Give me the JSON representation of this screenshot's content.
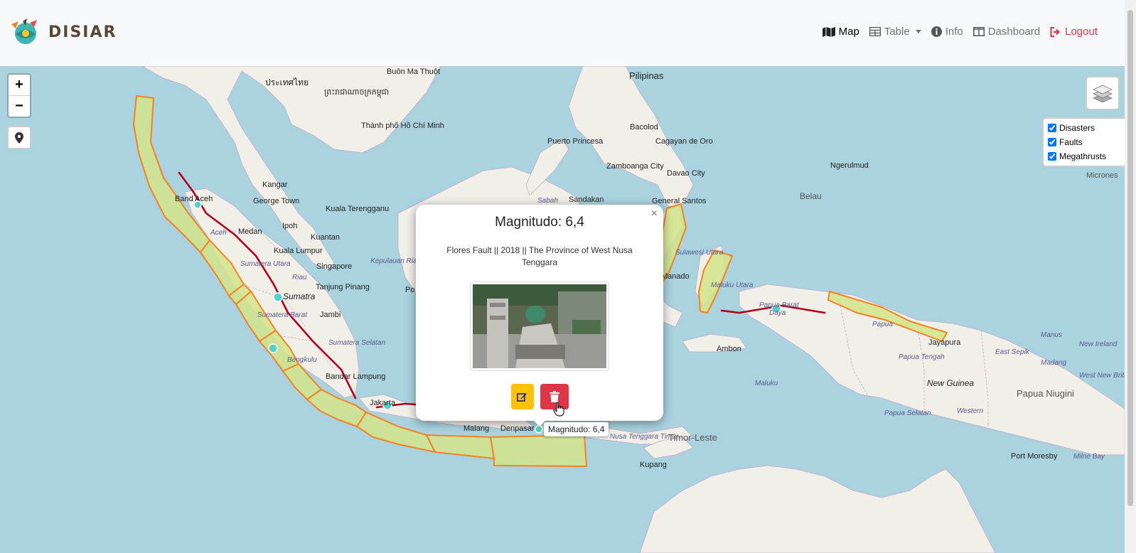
{
  "brand": {
    "name": "DISIAR"
  },
  "nav": {
    "map": "Map",
    "table": "Table",
    "info": "Info",
    "dashboard": "Dashboard",
    "logout": "Logout"
  },
  "map_controls": {
    "zoom_in": "+",
    "zoom_out": "−"
  },
  "layers": {
    "disasters": "Disasters",
    "faults": "Faults",
    "megathrusts": "Megathrusts"
  },
  "popup": {
    "title": "Magnitudo: 6,4",
    "description": "Flores Fault || 2018 || The Province of West Nusa Tenggara",
    "close": "×"
  },
  "tooltip": "Magnitudo: 6,4",
  "map_labels": {
    "pilipinas": "Pilipinas",
    "buon_ma_thuot": "Buôn Ma Thuột",
    "prathet_thai": "ประเทศไทย",
    "kampuchea": "ព្រះរាជាណាចក្រកម្ពុជា",
    "ho_chi_minh": "Thành phố Hồ Chí Minh",
    "puerto_princesa": "Puerto Princesa",
    "bacolod": "Bacolod",
    "cagayan": "Cagayan de Oro",
    "zamboanga": "Zamboanga City",
    "davao": "Davao City",
    "general_santos": "General Santos",
    "ngerulmud": "Ngerulmud",
    "belau": "Belau",
    "micronesia": "Micrones",
    "sandakan": "Sandakan",
    "sabah": "Sabah",
    "kangar": "Kangar",
    "george_town": "George Town",
    "kuala_terengganu": "Kuala Terengganu",
    "ipoh": "Ipoh",
    "kuantan": "Kuantan",
    "kuala_lumpur": "Kuala Lumpur",
    "singapore": "Singapore",
    "tanjung_pinang": "Tanjung Pinang",
    "banda_aceh": "Band Aceh",
    "aceh": "Aceh",
    "medan": "Medan",
    "sumatera_utara": "Sumatera Utara",
    "riau": "Riau",
    "kepulauan_riau": "Kepulauan Riau",
    "sumatra": "Sumatra",
    "sumatera_barat": "Sumatera Barat",
    "jambi": "Jambi",
    "sumatera_selatan": "Sumatera Selatan",
    "bengkulu": "Bengkulu",
    "bandar_lampung": "Bandar Lampung",
    "jakarta": "Jakarta",
    "malang": "Malang",
    "denpasar": "Denpasar",
    "nusa_tenggara_timur": "Nusa Tenggara Timur",
    "timor_leste": "Timor-Leste",
    "kupang": "Kupang",
    "ambon": "Ambon",
    "maluku": "Maluku",
    "maluku_utara": "Maluku Utara",
    "sulawesi_utara": "Sulawesi Utara",
    "manado": "Manado",
    "papua_barat": "Papua Barat",
    "papua_barat_daya": "Daya",
    "papua": "Papua",
    "jayapura": "Jayapura",
    "papua_tengah": "Papua Tengah",
    "papua_selatan": "Papua Selatan",
    "new_guinea": "New Guinea",
    "papua_niugini": "Papua Niugini",
    "western": "Western",
    "manus": "Manus",
    "east_sepik": "East Sepik",
    "madang": "Madang",
    "new_ireland": "New Ireland",
    "west_new_britain": "West New Britain",
    "port_moresby": "Port Moresby",
    "milne_bay": "Milne Bay",
    "po": "Po"
  },
  "colors": {
    "water": "#aad3df",
    "land": "#f2efe9",
    "megathrust_fill": "#d4e48a",
    "megathrust_stroke": "#f58220",
    "fault": "#b3001b",
    "edit": "#ffc107",
    "delete": "#dc3545"
  }
}
